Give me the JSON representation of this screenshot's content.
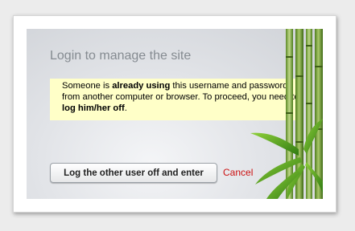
{
  "dialog": {
    "title": "Login to manage the site",
    "notice": {
      "part1": "Someone is ",
      "bold1": "already using",
      "part2": " this username and password from another computer or browser. To proceed, you need to ",
      "bold2": "log him/her off",
      "part3": "."
    },
    "primary_button_label": "Log the other user off and enter",
    "cancel_label": "Cancel"
  },
  "colors": {
    "notice_background": "#ffffc8",
    "cancel_link": "#cc1111",
    "title_text": "#858b91"
  },
  "icons": {
    "decoration": "bamboo-illustration"
  }
}
